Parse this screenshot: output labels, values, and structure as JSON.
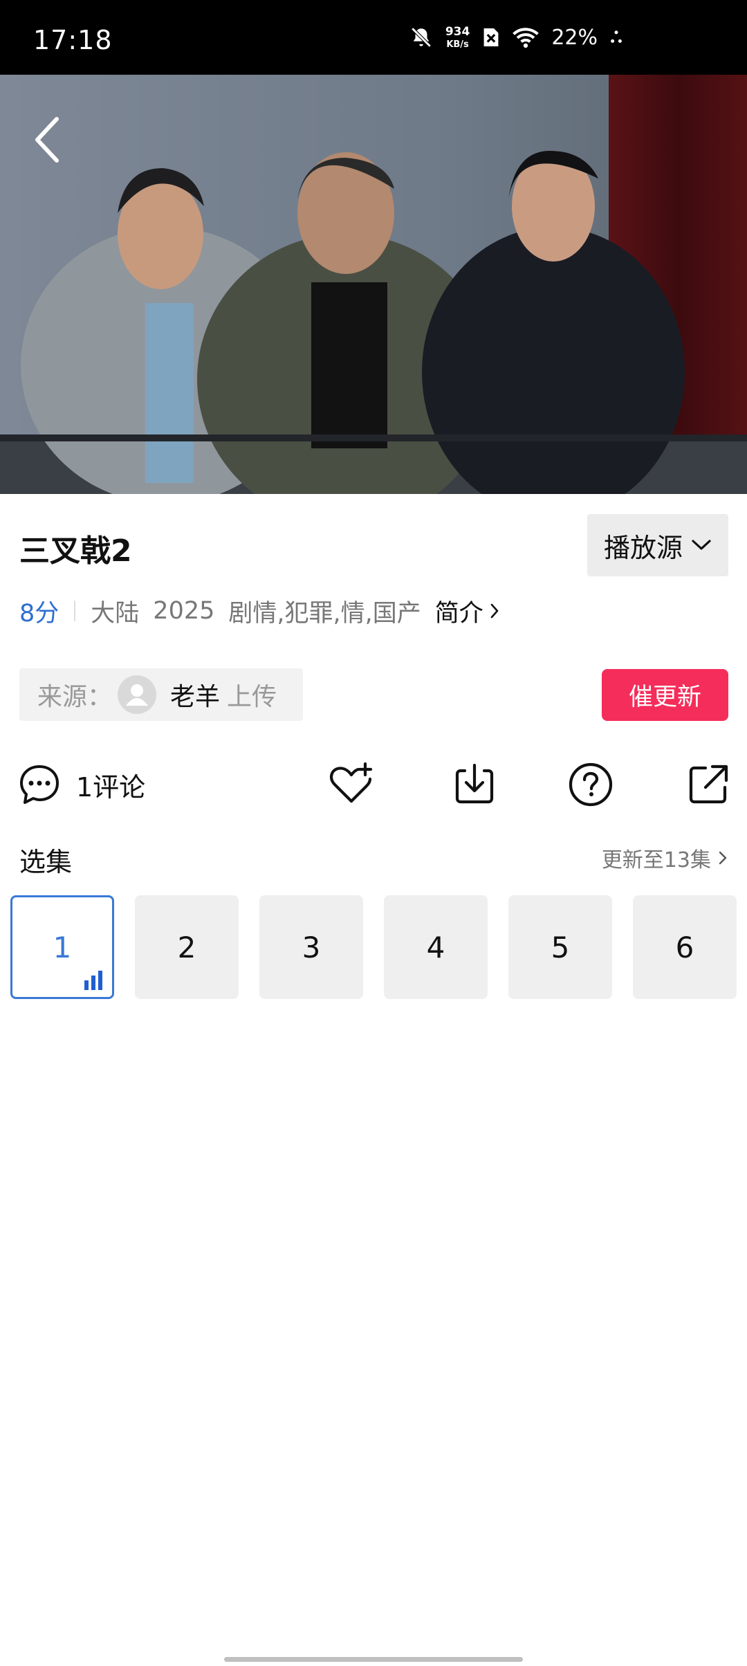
{
  "status_bar": {
    "time": "17:18",
    "net_speed_value": "934",
    "net_speed_unit": "KB/s",
    "battery": "22%",
    "icons": [
      "bell-off-icon",
      "no-sim-icon",
      "wifi-icon",
      "activity-dots-icon"
    ]
  },
  "video": {
    "back_icon": "chevron-left-icon"
  },
  "title": "三叉戟2",
  "source_select": {
    "label": "播放源",
    "icon": "chevron-down-icon"
  },
  "meta": {
    "score": "8分",
    "region": "大陆",
    "year": "2025",
    "genres": "剧情,犯罪,情,国产",
    "intro_label": "简介"
  },
  "uploader": {
    "label": "来源：",
    "name": "老羊",
    "suffix": "上传"
  },
  "urge_button": "催更新",
  "actions": {
    "comment_label": "1评论",
    "icons": [
      "comment-icon",
      "favorite-add-icon",
      "download-icon",
      "help-icon",
      "share-icon"
    ]
  },
  "episodes": {
    "title": "选集",
    "update_text": "更新至13集",
    "items": [
      "1",
      "2",
      "3",
      "4",
      "5",
      "6"
    ],
    "active_index": 0
  },
  "colors": {
    "accent_blue": "#2d6fd1",
    "urge_red": "#f52d5a",
    "status_bar_bg": "#000000"
  }
}
